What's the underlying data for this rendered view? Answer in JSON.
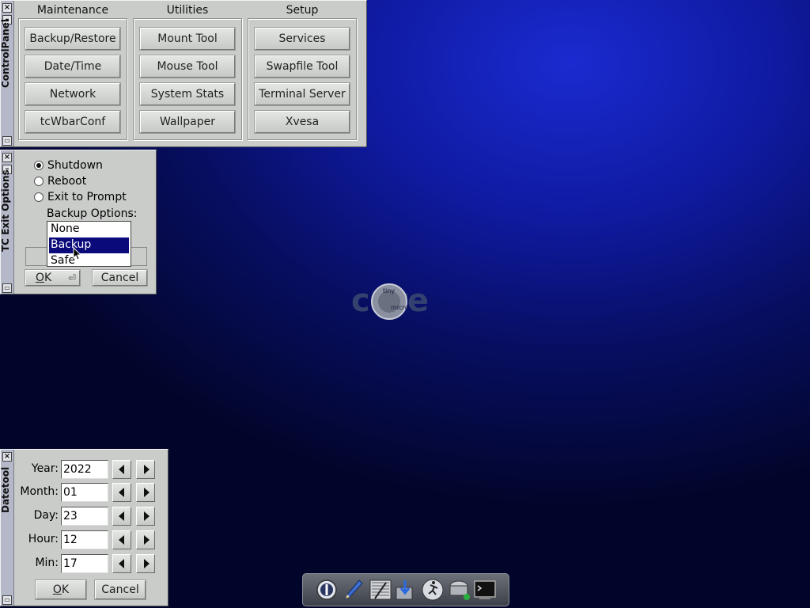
{
  "control_panel": {
    "title": "ControlPanel",
    "groups": [
      {
        "label": "Maintenance",
        "buttons": [
          "Backup/Restore",
          "Date/Time",
          "Network",
          "tcWbarConf"
        ]
      },
      {
        "label": "Utilities",
        "buttons": [
          "Mount Tool",
          "Mouse Tool",
          "System Stats",
          "Wallpaper"
        ]
      },
      {
        "label": "Setup",
        "buttons": [
          "Services",
          "Swapfile Tool",
          "Terminal Server",
          "Xvesa"
        ]
      }
    ]
  },
  "exit_options": {
    "title": "TC Exit Options",
    "radios": [
      {
        "label": "Shutdown",
        "checked": true
      },
      {
        "label": "Reboot",
        "checked": false
      },
      {
        "label": "Exit to Prompt",
        "checked": false
      }
    ],
    "backup_label": "Backup Options:",
    "dropdown_options": [
      "None",
      "Backup",
      "Safe"
    ],
    "dropdown_selected": "Backup",
    "ok_label": "OK",
    "ok_mnemonic": "O",
    "ok_rest": "K",
    "ok_glyph": "⏎",
    "cancel_label": "Cancel"
  },
  "datetool": {
    "title": "Datetool",
    "fields": [
      {
        "label": "Year:",
        "value": "2022"
      },
      {
        "label": "Month:",
        "value": "01"
      },
      {
        "label": "Day:",
        "value": "23"
      },
      {
        "label": "Hour:",
        "value": "12"
      },
      {
        "label": "Min:",
        "value": "17"
      }
    ],
    "ok_label": "OK",
    "ok_mnemonic": "O",
    "ok_rest": "K",
    "cancel_label": "Cancel"
  },
  "desktop": {
    "logo_text": "core",
    "logo_inner_top": "tiny",
    "logo_inner_bottom": "micro",
    "window_controls": {
      "minimize": "–",
      "close": "×",
      "shade": "▭"
    }
  },
  "dock": {
    "icons": [
      "exit-icon",
      "editor-icon",
      "apps-icon",
      "installer-icon",
      "run-icon",
      "mount-icon",
      "terminal-icon"
    ]
  }
}
